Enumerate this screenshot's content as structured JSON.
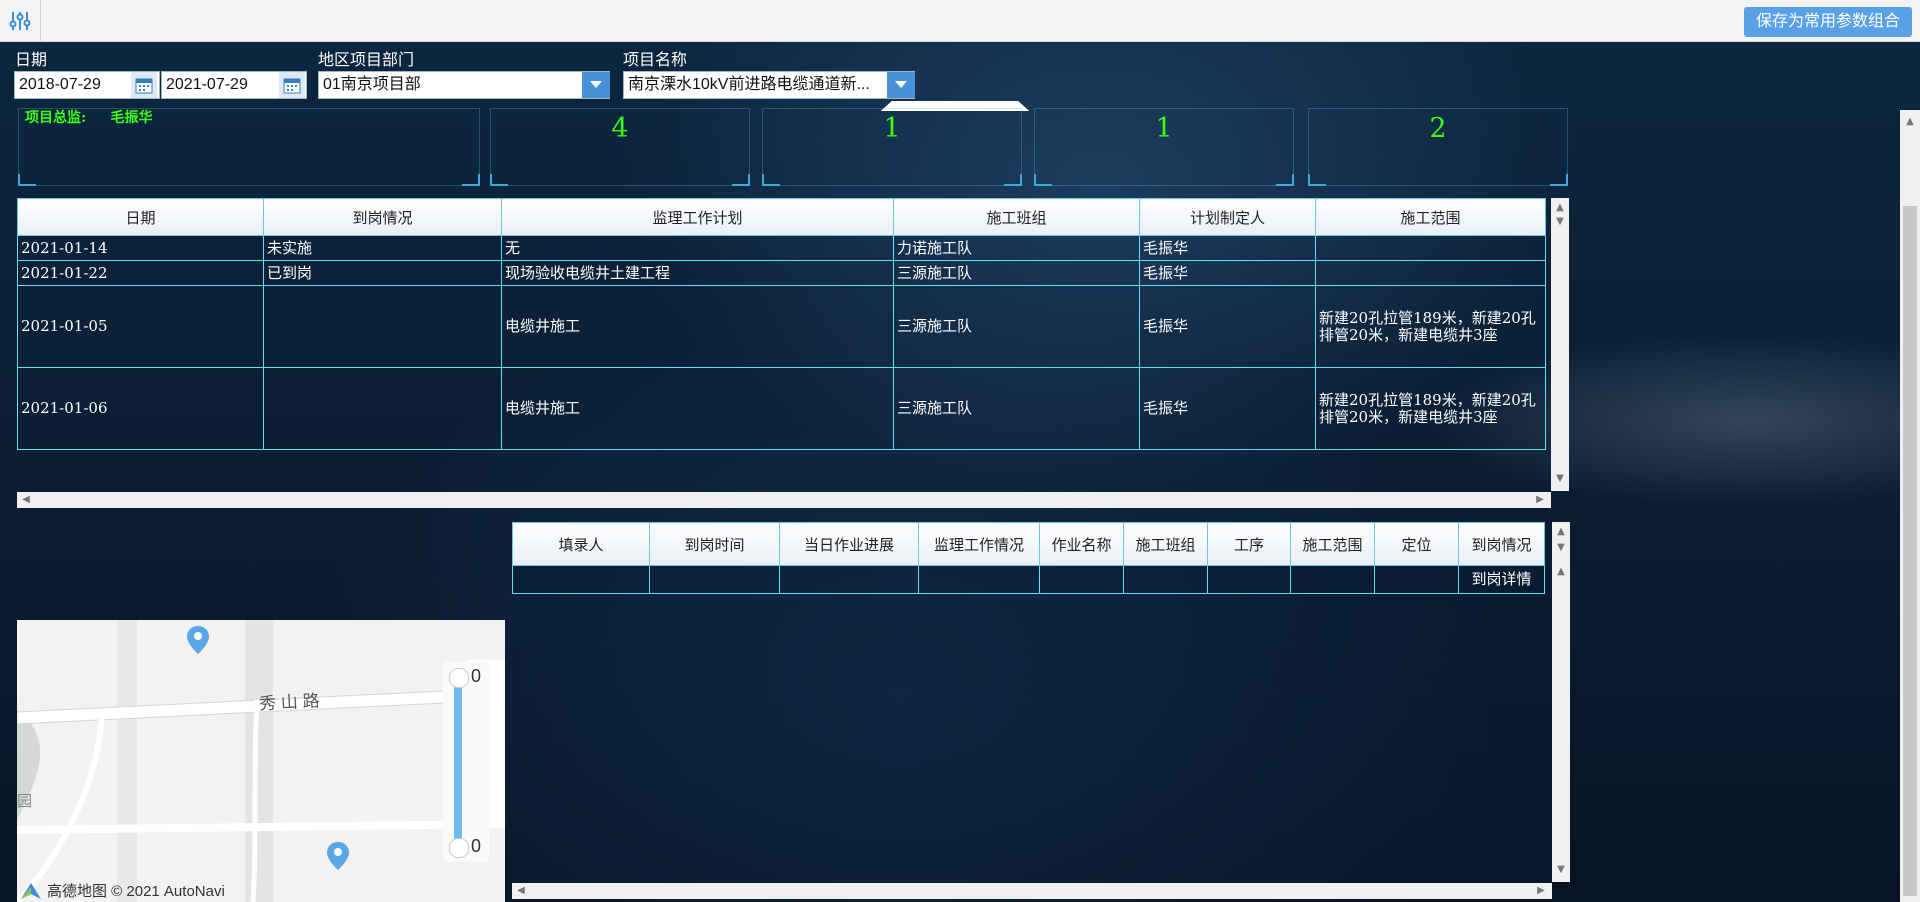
{
  "toolbar": {
    "settings_icon": "sliders-icon",
    "save_combo_label": "保存为常用参数组合"
  },
  "filters": {
    "date_label": "日期",
    "start_date": "2018-07-29",
    "end_date": "2021-07-29",
    "dept_label": "地区项目部门",
    "dept_value": "01南京项目部",
    "project_label": "项目名称",
    "project_value": "南京溧水10kV前进路电缆通道新..."
  },
  "kpis": {
    "director_label": "项目总监:",
    "director_name": "毛振华",
    "values": [
      "4",
      "1",
      "1",
      "2"
    ]
  },
  "plan_table": {
    "headers": [
      "日期",
      "到岗情况",
      "监理工作计划",
      "施工班组",
      "计划制定人",
      "施工范围"
    ],
    "rows": [
      [
        "2021-01-14",
        "未实施",
        "无",
        "力诺施工队",
        "毛振华",
        ""
      ],
      [
        "2021-01-22",
        "已到岗",
        "现场验收电缆井土建工程",
        "三源施工队",
        "毛振华",
        ""
      ],
      [
        "2021-01-05",
        "",
        "电缆井施工",
        "三源施工队",
        "毛振华",
        "新建20孔拉管189米，新建20孔排管20米，新建电缆井3座"
      ],
      [
        "2021-01-06",
        "",
        "电缆井施工",
        "三源施工队",
        "毛振华",
        "新建20孔拉管189米，新建20孔排管20米，新建电缆井3座"
      ]
    ]
  },
  "report_table": {
    "headers": [
      "填录人",
      "到岗时间",
      "当日作业进展",
      "监理工作情况",
      "作业名称",
      "施工班组",
      "工序",
      "施工范围",
      "定位",
      "到岗情况"
    ],
    "sub_label": "到岗详情"
  },
  "map": {
    "road_label": "秀 山 路",
    "park_label": "园",
    "slider_top": "0",
    "slider_bottom": "0",
    "attribution": "高德地图 © 2021 AutoNavi"
  }
}
